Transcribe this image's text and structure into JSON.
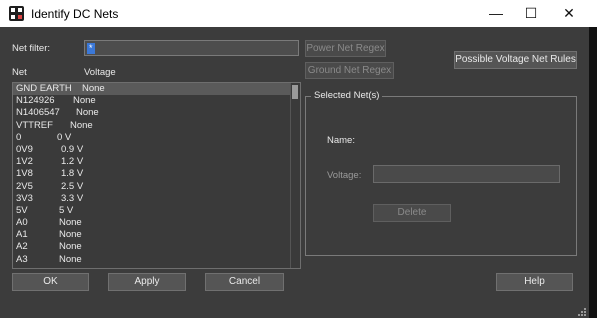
{
  "window": {
    "title": "Identify DC Nets"
  },
  "filter": {
    "label": "Net filter:",
    "value": "*"
  },
  "buttons": {
    "power_regex": "Power Net Regex",
    "ground_regex": "Ground Net Regex",
    "possible_rules": "Possible Voltage Net Rules",
    "delete": "Delete",
    "ok": "OK",
    "apply": "Apply",
    "cancel": "Cancel",
    "help": "Help"
  },
  "list": {
    "col_net": "Net",
    "col_voltage": "Voltage",
    "rows": [
      {
        "net": "GND EARTH",
        "voltage": "None"
      },
      {
        "net": "N124926",
        "voltage": "None"
      },
      {
        "net": "N1406547",
        "voltage": "None"
      },
      {
        "net": "VTTREF",
        "voltage": "None"
      },
      {
        "net": "0",
        "voltage": "0 V"
      },
      {
        "net": "0V9",
        "voltage": "0.9 V"
      },
      {
        "net": "1V2",
        "voltage": "1.2 V"
      },
      {
        "net": "1V8",
        "voltage": "1.8 V"
      },
      {
        "net": "2V5",
        "voltage": "2.5 V"
      },
      {
        "net": "3V3",
        "voltage": "3.3 V"
      },
      {
        "net": "5V",
        "voltage": "5 V"
      },
      {
        "net": "A0",
        "voltage": "None"
      },
      {
        "net": "A1",
        "voltage": "None"
      },
      {
        "net": "A2",
        "voltage": "None"
      },
      {
        "net": "A3",
        "voltage": "None"
      }
    ]
  },
  "selected": {
    "group_title": "Selected Net(s)",
    "name_label": "Name:",
    "voltage_label": "Voltage:"
  }
}
